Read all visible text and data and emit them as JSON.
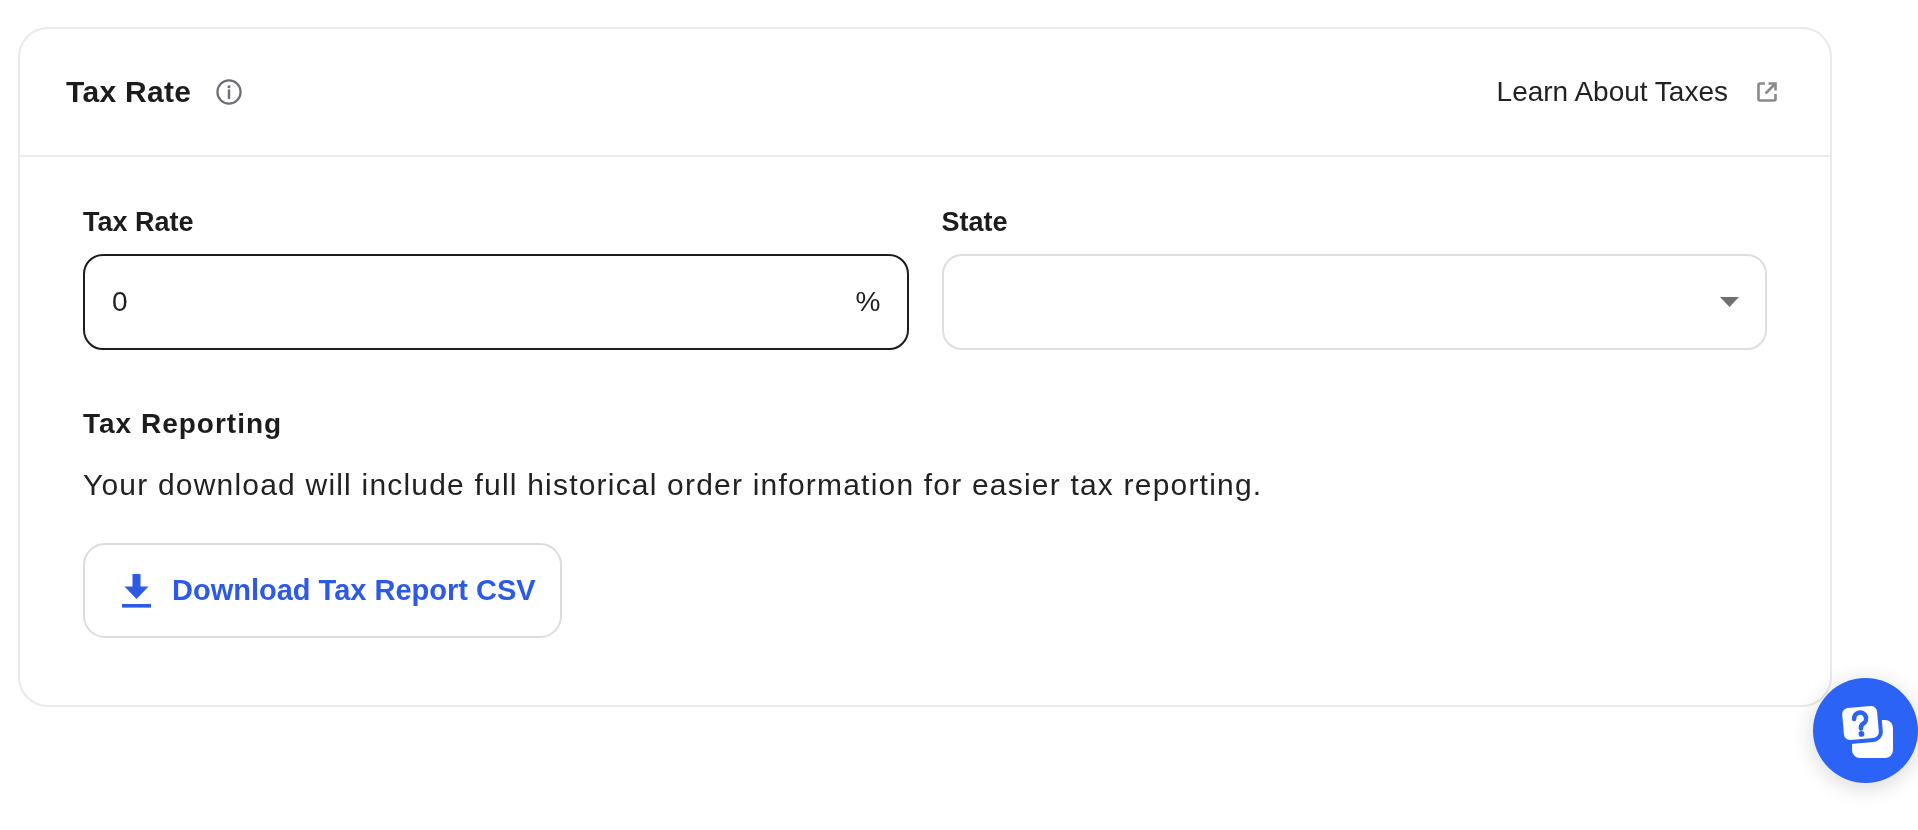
{
  "header": {
    "title": "Tax Rate",
    "link": "Learn About Taxes"
  },
  "fields": [
    {
      "kind": "number",
      "label": "Tax Rate",
      "value": "0",
      "suffix": "%",
      "focused": true
    },
    {
      "kind": "select",
      "label": "State",
      "focused": false
    }
  ],
  "reporting": {
    "title": "Tax Reporting",
    "description": "Your download will include full historical order information for easier tax reporting.",
    "button": "Download Tax Report CSV"
  }
}
